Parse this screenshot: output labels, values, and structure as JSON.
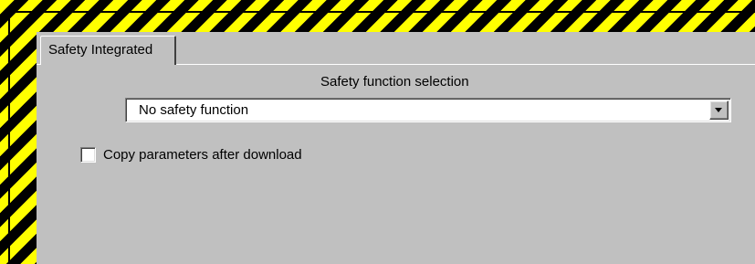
{
  "tabs": [
    {
      "label": "Safety Integrated",
      "active": true
    }
  ],
  "safety_function": {
    "label": "Safety function selection",
    "selected_value": "No safety function"
  },
  "copy_parameters": {
    "label": "Copy parameters after download",
    "checked": false
  },
  "colors": {
    "panel": "#c0c0c0",
    "stripe_yellow": "#ffff00",
    "stripe_black": "#000000",
    "field_bg": "#ffffff"
  }
}
